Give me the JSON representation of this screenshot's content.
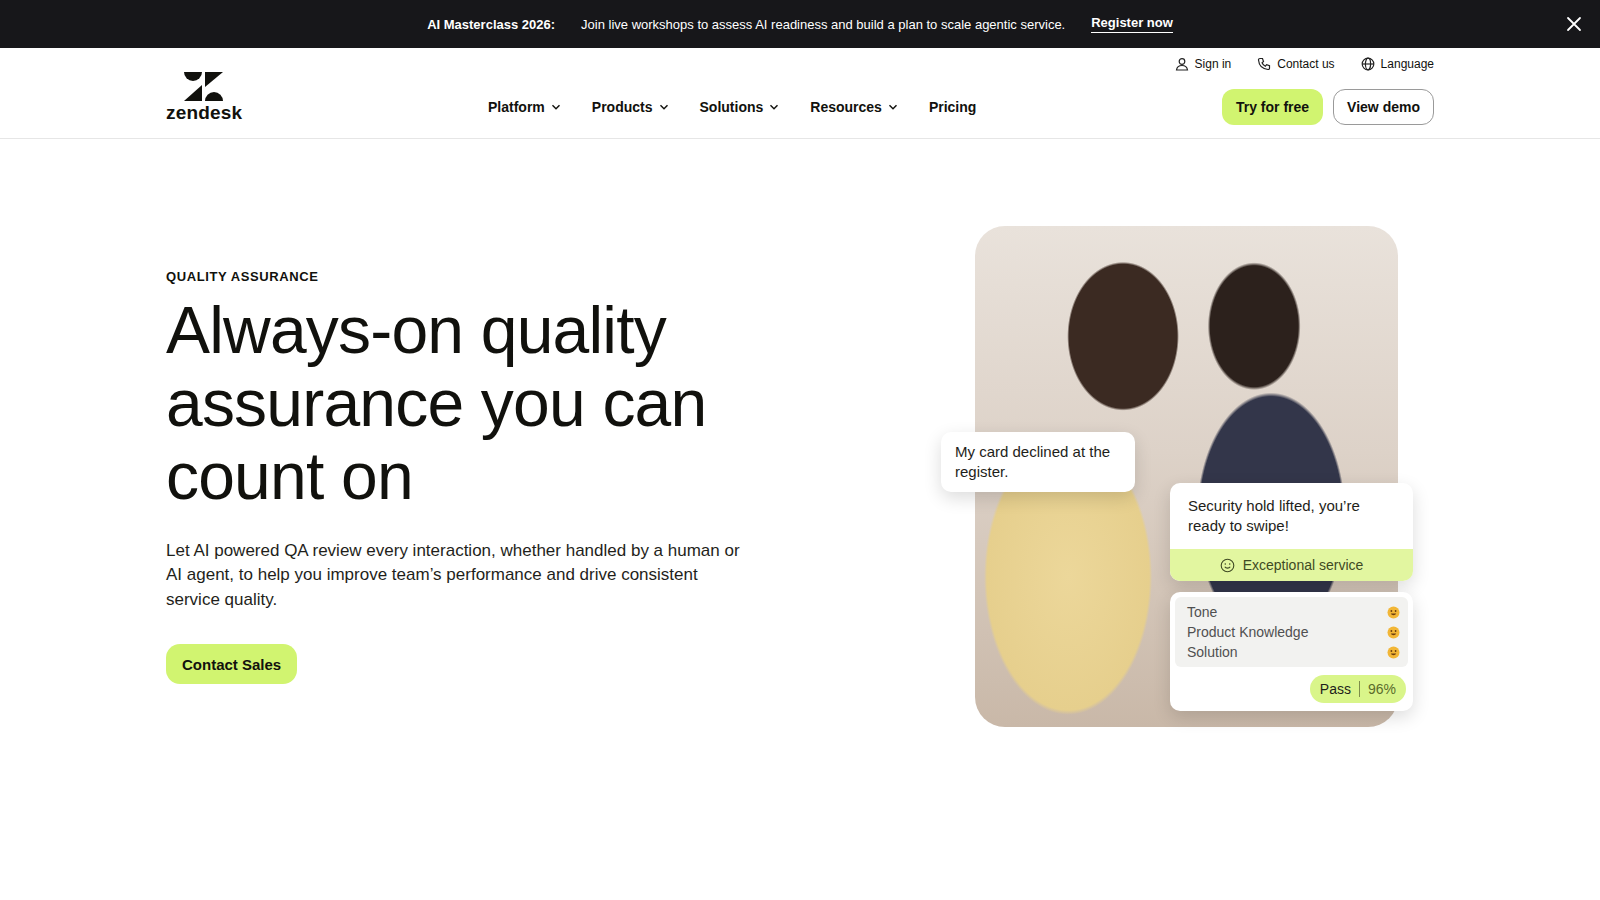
{
  "banner": {
    "title": "AI Masterclass 2026:",
    "text": "Join live workshops to assess AI readiness and build a plan to scale agentic service.",
    "link": "Register now"
  },
  "logo": {
    "text": "zendesk"
  },
  "utility_links": [
    {
      "label": "Sign in"
    },
    {
      "label": "Contact us"
    },
    {
      "label": "Language"
    }
  ],
  "nav": [
    {
      "label": "Platform",
      "dropdown": true
    },
    {
      "label": "Products",
      "dropdown": true
    },
    {
      "label": "Solutions",
      "dropdown": true
    },
    {
      "label": "Resources",
      "dropdown": true
    },
    {
      "label": "Pricing",
      "dropdown": false
    }
  ],
  "header_buttons": [
    {
      "label": "Try for free",
      "kind": "primary"
    },
    {
      "label": "View demo",
      "kind": "outline"
    }
  ],
  "hero": {
    "eyebrow": "QUALITY ASSURANCE",
    "title": "Always-on quality assurance you can count on",
    "description": "Let AI powered QA review every interaction, whether handled by a human or AI agent, to help you improve team’s performance and drive consistent service quality.",
    "cta": "Contact Sales"
  },
  "illustration": {
    "customer_message": "My card declined at the register.",
    "agent_message": "Security hold lifted, you’re ready to swipe!",
    "rating": "Exceptional service",
    "criteria": [
      {
        "label": "Tone"
      },
      {
        "label": "Product Knowledge"
      },
      {
        "label": "Solution"
      }
    ],
    "result": "Pass",
    "score": "96%"
  }
}
